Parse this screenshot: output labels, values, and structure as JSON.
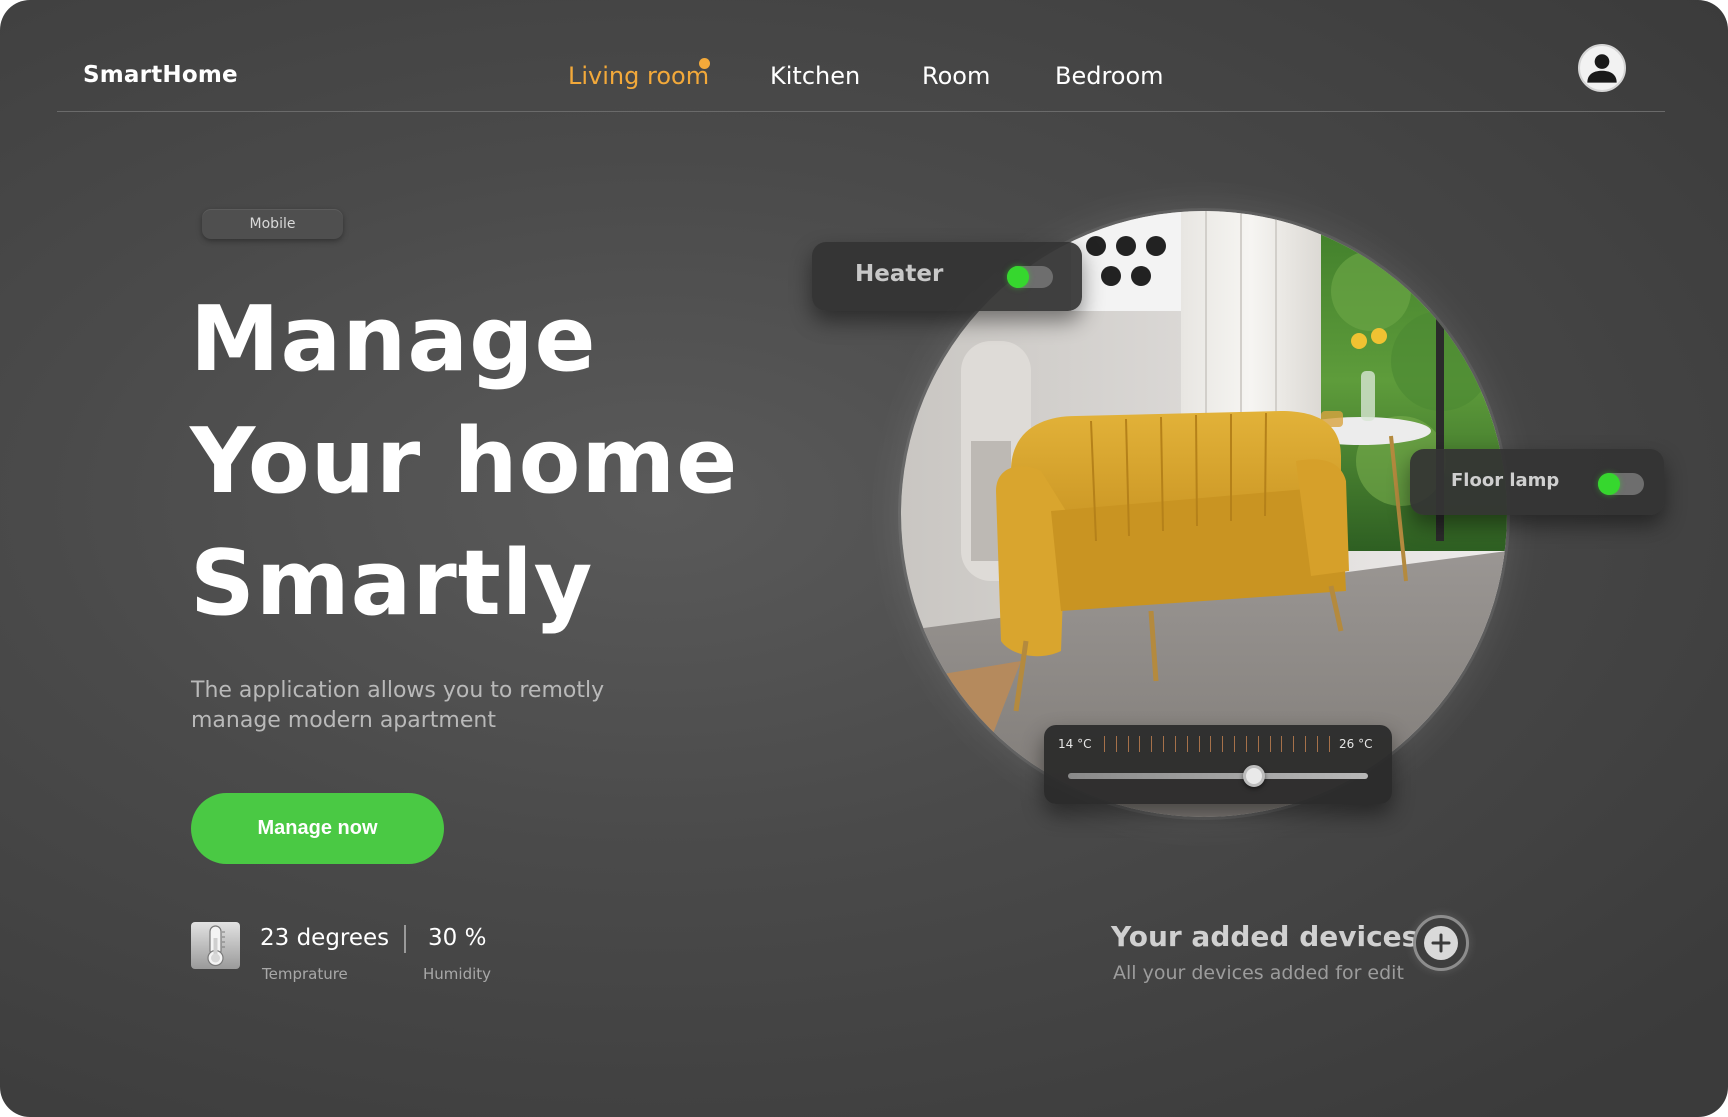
{
  "app": {
    "logo": "SmartHome"
  },
  "nav": {
    "items": [
      {
        "label": "Living room",
        "active": true
      },
      {
        "label": "Kitchen",
        "active": false
      },
      {
        "label": "Room",
        "active": false
      },
      {
        "label": "Bedroom",
        "active": false
      }
    ]
  },
  "hero": {
    "tag": "Mobile",
    "title_lines": [
      "Manage",
      "Your home",
      "Smartly"
    ],
    "subtitle": "The application allows you to remotly manage modern apartment",
    "cta": "Manage now"
  },
  "stats": {
    "temperature": {
      "value": "23 degrees",
      "label": "Temprature"
    },
    "humidity": {
      "value": "30 %",
      "label": "Humidity"
    }
  },
  "devices": {
    "heater": {
      "label": "Heater",
      "on": true
    },
    "floor_lamp": {
      "label": "Floor lamp",
      "on": true
    }
  },
  "thermostat": {
    "min_label": "14 °C",
    "max_label": "26 °C",
    "level": 0.62
  },
  "added_devices": {
    "title": "Your added devices",
    "subtitle": "All your devices added for edit"
  },
  "colors": {
    "accent_orange": "#f3a93a",
    "accent_green": "#4ac944",
    "toggle_on": "#36d72e"
  },
  "icons": [
    "user-avatar-icon",
    "thermometer-icon",
    "plus-icon"
  ]
}
